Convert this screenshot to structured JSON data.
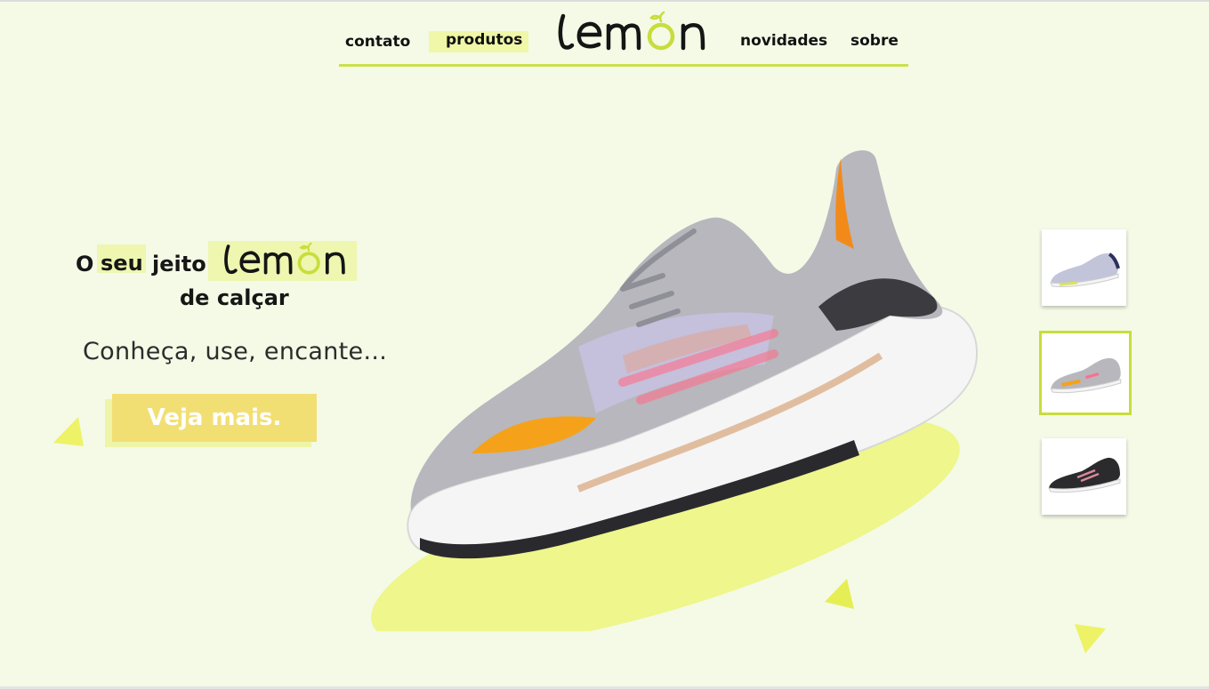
{
  "nav": {
    "items": [
      {
        "label": "contato"
      },
      {
        "label": "produtos",
        "active": true
      },
      {
        "label": "novidades"
      },
      {
        "label": "sobre"
      }
    ],
    "logo_text": "lemon"
  },
  "hero": {
    "title_o": "O",
    "title_seu": "seu",
    "title_jeito": "jeito",
    "title_logo": "lemon",
    "title_line2": "de calçar",
    "subtitle": "Conheça, use, encante...",
    "cta_label": "Veja mais."
  },
  "thumbnails": [
    {
      "variant": "lilac-yellow",
      "selected": false
    },
    {
      "variant": "grey-orange",
      "selected": true
    },
    {
      "variant": "black-pink",
      "selected": false
    }
  ],
  "colors": {
    "background": "#f4fae6",
    "accent_lime": "#cbe04a",
    "highlight": "#eef6b0",
    "cta": "#f2df74",
    "triangle": "#eef266"
  },
  "icons": [
    "lemon-logo-icon",
    "sneaker-image",
    "triangle-decoration"
  ]
}
